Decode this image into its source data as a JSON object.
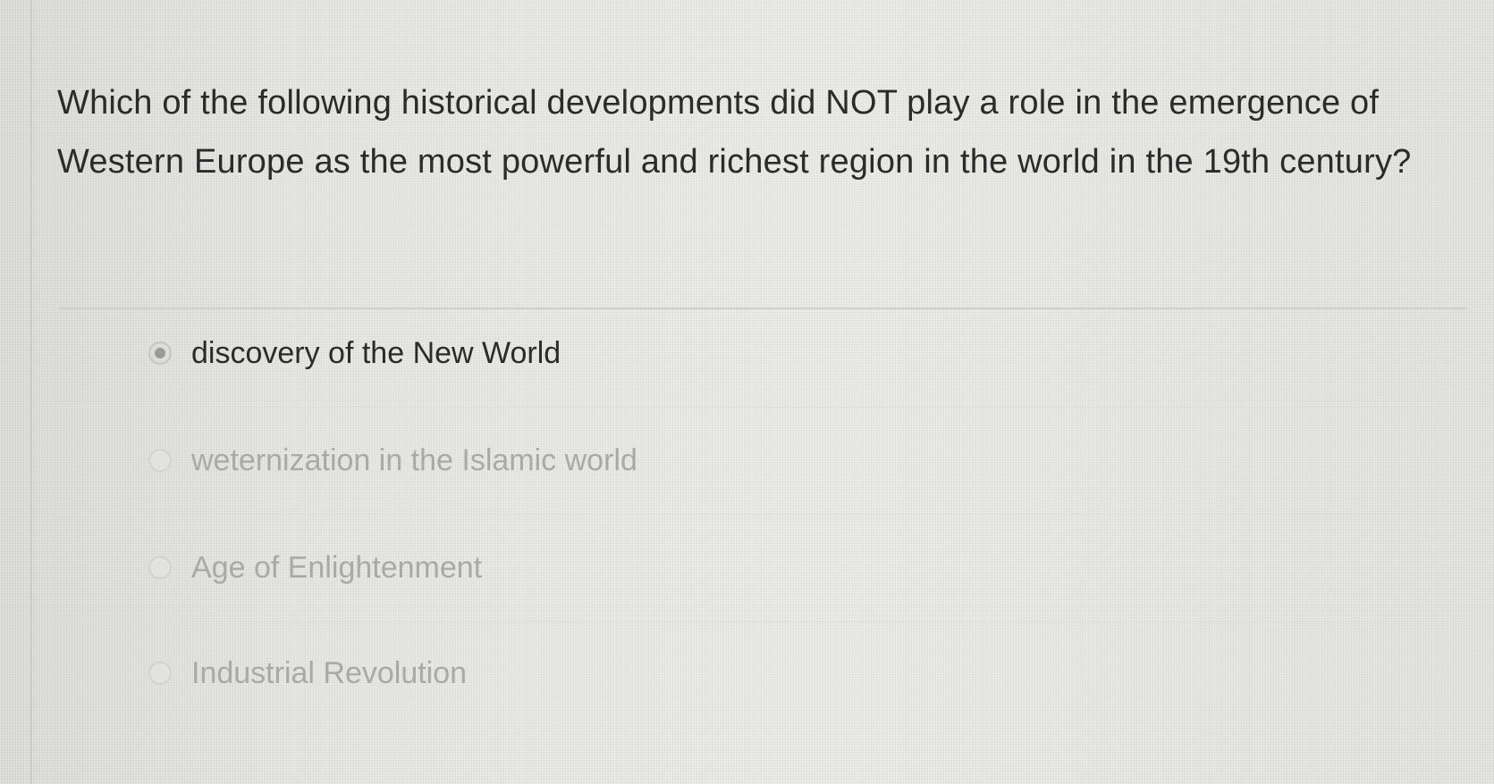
{
  "question": {
    "text": "Which of the following historical developments did NOT play a role in the emergence of Western Europe as the most powerful and richest region in the world in the 19th century?"
  },
  "options": [
    {
      "label": "discovery of the New World",
      "selected": true
    },
    {
      "label": "weternization in the Islamic world",
      "selected": false
    },
    {
      "label": "Age of Enlightenment",
      "selected": false
    },
    {
      "label": "Industrial Revolution",
      "selected": false
    }
  ],
  "colors": {
    "background": "#e7e7e5",
    "text": "#2b2b2b",
    "faded_text": "#a9a9a6",
    "divider": "#d0d0cd"
  }
}
